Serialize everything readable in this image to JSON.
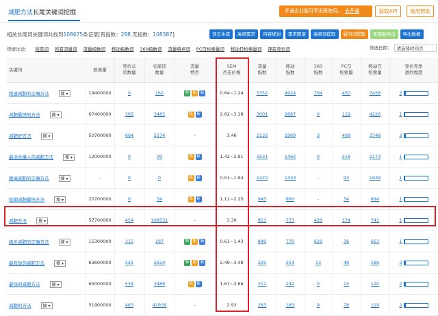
{
  "header": {
    "title_main": "减肥方法",
    "title_sub": "长尾关键词挖掘",
    "promo_text": "开通企业版可享无限使用，",
    "promo_link": "去开通",
    "api_button": "获取API",
    "help_button": "使用帮助"
  },
  "summary": {
    "prefix": "相关长尾词关键词共找到",
    "total": "108675",
    "mid": "条记录[有指数：",
    "with_index": "288",
    "mid2": " 无指数：",
    "without_index": "108387",
    "suffix": "]"
  },
  "toolbar": {
    "buttons": [
      "词云生成",
      "高频需求",
      "内容规划",
      "需求图谱",
      "高频词提取",
      "疑问词提取",
      "无限制导出",
      "导出数据"
    ]
  },
  "filters": {
    "label": "快捷过滤：",
    "items": [
      "所有词",
      "所有流量词",
      "流量指数词",
      "移动指数词",
      "360指数词",
      "流量特点词",
      "PC日检索量词",
      "移动日检索量词",
      "存在竞价词"
    ],
    "sort_label": "筛选日期：",
    "sort_value": "请选择时间点"
  },
  "table": {
    "headers": {
      "keyword": "关键词",
      "volume": "收录量",
      "bid_companies": "竞价公\n司数量",
      "long_tail": "长尾词\n数量",
      "traffic_feature": "流量\n特点",
      "sem": "SEM\n点击价格",
      "traffic_index": "流量\n指数",
      "mobile_index": "移动\n指数",
      "index_360": "360\n指数",
      "pc_daily": "PC日\n检索量",
      "mobile_daily": "移动日\n检索量",
      "competition": "竞价竞争\n激烈程度"
    },
    "select_label": "搜",
    "rows": [
      {
        "keyword": "跑速减肥的正确方法",
        "volume": "19400000",
        "bid": "0",
        "longtail": "162",
        "tags": [
          "g",
          "o",
          "b"
        ],
        "sem": "0.64~1.24",
        "traffic": "5352",
        "mobile": "4924",
        "i360": "794",
        "pc": "450",
        "mdaily": "7458",
        "comp": "2",
        "level": 0.06
      },
      {
        "keyword": "减肥最快的方法",
        "volume": "67400000",
        "bid": "365",
        "longtail": "3485",
        "tags": [
          "o",
          "b"
        ],
        "sem": "2.62~3.18",
        "traffic": "3001",
        "mobile": "2887",
        "i360": "0",
        "pc": "119",
        "mdaily": "4226",
        "comp": "1",
        "level": 0.04
      },
      {
        "keyword": "减肥好方法",
        "volume": "50700000",
        "bid": "664",
        "longtail": "5574",
        "tags": [],
        "sem": "3.46",
        "traffic": "2133",
        "mobile": "1909",
        "i360": "3",
        "pc": "409",
        "mdaily": "3748",
        "comp": "2",
        "level": 0.06
      },
      {
        "keyword": "最适合懒人的减肥方法",
        "volume": "12000000",
        "bid": "0",
        "longtail": "39",
        "tags": [
          "o",
          "b"
        ],
        "sem": "1.42~2.91",
        "traffic": "1631",
        "mobile": "1462",
        "i360": "0",
        "pc": "218",
        "mdaily": "2173",
        "comp": "1",
        "level": 0.04
      },
      {
        "keyword": "跳绳减肥的正确方法",
        "volume": "-",
        "bid": "0",
        "longtail": "0",
        "tags": [
          "o",
          "b"
        ],
        "sem": "0.51~1.94",
        "traffic": "1470",
        "mobile": "1333",
        "i360": "-",
        "pc": "93",
        "mdaily": "1939",
        "comp": "1",
        "level": 0.04
      },
      {
        "keyword": "经期减肥最快方法",
        "volume": "20700000",
        "bid": "0",
        "longtail": "34",
        "tags": [
          "o",
          "b"
        ],
        "sem": "1.11~2.25",
        "traffic": "943",
        "mobile": "860",
        "i360": "-",
        "pc": "34",
        "mdaily": "894",
        "comp": "1",
        "level": 0.04
      },
      {
        "keyword": "减肥方法",
        "volume": "57700000",
        "bid": "454",
        "longtail": "108531",
        "tags": [],
        "sem": "3.30",
        "traffic": "911",
        "mobile": "777",
        "i360": "429",
        "pc": "174",
        "mdaily": "741",
        "comp": "1",
        "level": 0.04
      },
      {
        "keyword": "跑步减肥的正确方法",
        "volume": "15300000",
        "bid": "315",
        "longtail": "197",
        "tags": [
          "g",
          "o",
          "b"
        ],
        "sem": "0.61~1.43",
        "traffic": "849",
        "mobile": "770",
        "i360": "629",
        "pc": "36",
        "mdaily": "663",
        "comp": "1",
        "level": 0.04
      },
      {
        "keyword": "最有效的减肥方法",
        "volume": "63600000",
        "bid": "525",
        "longtail": "2620",
        "tags": [
          "g",
          "o",
          "b"
        ],
        "sem": "2.49~3.48",
        "traffic": "325",
        "mobile": "254",
        "i360": "13",
        "pc": "49",
        "mdaily": "186",
        "comp": "2",
        "level": 0.06
      },
      {
        "keyword": "最快的减肥方法",
        "volume": "65000000",
        "bid": "534",
        "longtail": "3489",
        "tags": [
          "o",
          "b"
        ],
        "sem": "1.67~3.66",
        "traffic": "311",
        "mobile": "242",
        "i360": "0",
        "pc": "15",
        "mdaily": "120",
        "comp": "2",
        "level": 0.06
      },
      {
        "keyword": "减肥的方法",
        "volume": "51900000",
        "bid": "463",
        "longtail": "42939",
        "tags": [],
        "sem": "2.93",
        "traffic": "263",
        "mobile": "183",
        "i360": "9",
        "pc": "78",
        "mdaily": "119",
        "comp": "2",
        "level": 0.06
      }
    ]
  },
  "tag_labels": {
    "g": "移",
    "o": "拓",
    "b": "新"
  },
  "colors": {
    "accent": "#1b74d1",
    "promo": "#f08a1a",
    "highlight": "#d8232a"
  }
}
